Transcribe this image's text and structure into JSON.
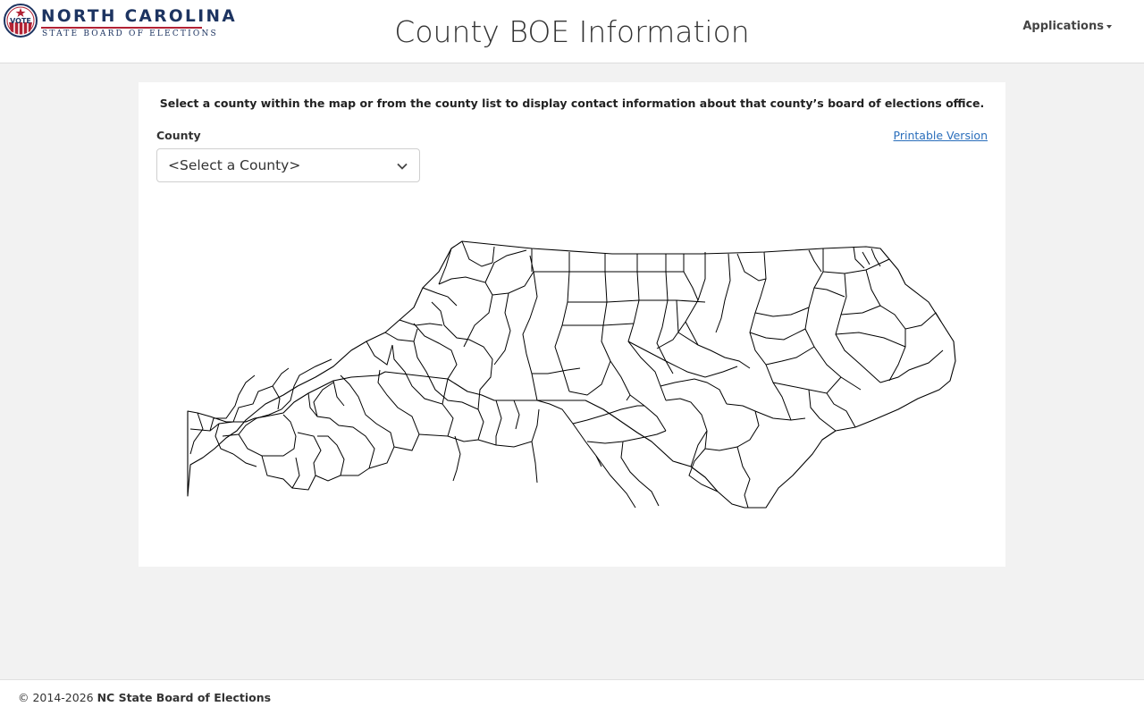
{
  "header": {
    "logo_title": "NORTH CAROLINA",
    "logo_subtitle": "STATE BOARD OF ELECTIONS",
    "logo_badge": "VOTE",
    "page_title": "County BOE Information",
    "apps_menu_label": "Applications"
  },
  "main": {
    "instructions": "Select a county within the map or from the county list to display contact information about that county’s board of elections office.",
    "county_label": "County",
    "printable_link": "Printable Version",
    "county_select": {
      "selected": "<Select a County>"
    }
  },
  "footer": {
    "copyright": "© 2014-2026",
    "org": "NC State Board of Elections"
  },
  "colors": {
    "brand_navy": "#1d3461",
    "brand_red": "#b22234",
    "link": "#2a6ebb"
  }
}
